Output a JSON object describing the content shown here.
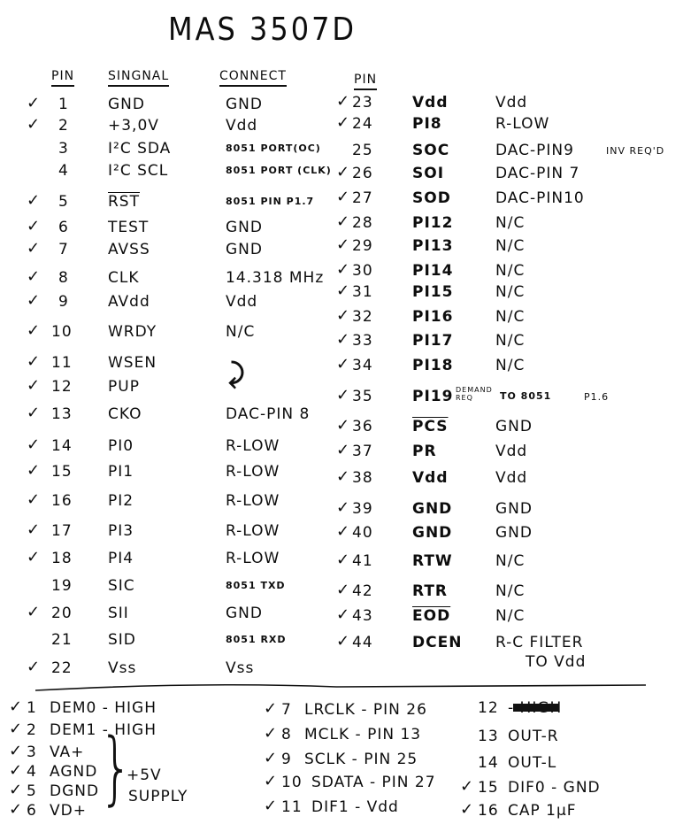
{
  "title": "MAS 3507D",
  "headers": {
    "pin": "PIN",
    "signal": "SINGNAL",
    "connect": "CONNECT",
    "pin2": "PIN"
  },
  "left_pins": [
    {
      "check": "✓",
      "pin": "1",
      "signal": "GND",
      "connect": "GND"
    },
    {
      "check": "✓",
      "pin": "2",
      "signal": "+3,0V",
      "connect": "Vdd"
    },
    {
      "check": "",
      "pin": "3",
      "signal": "I²C SDA",
      "connect": "8051 PORT(OC)"
    },
    {
      "check": "",
      "pin": "4",
      "signal": "I²C SCL",
      "connect": "8051 PORT (CLK)"
    },
    {
      "check": "✓",
      "pin": "5",
      "signal": "RST",
      "connect": "8051 PIN P1.7",
      "overline": true
    },
    {
      "check": "✓",
      "pin": "6",
      "signal": "TEST",
      "connect": "GND"
    },
    {
      "check": "✓",
      "pin": "7",
      "signal": "AVSS",
      "connect": "GND"
    },
    {
      "check": "✓",
      "pin": "8",
      "signal": "CLK",
      "connect": "14.318 MHz"
    },
    {
      "check": "✓",
      "pin": "9",
      "signal": "AVdd",
      "connect": "Vdd"
    },
    {
      "check": "✓",
      "pin": "10",
      "signal": "WRDY",
      "connect": "N/C"
    },
    {
      "check": "✓",
      "pin": "11",
      "signal": "WSEN",
      "connect": ""
    },
    {
      "check": "✓",
      "pin": "12",
      "signal": "PUP",
      "connect": ""
    },
    {
      "check": "✓",
      "pin": "13",
      "signal": "CKO",
      "connect": "DAC-PIN 8"
    },
    {
      "check": "✓",
      "pin": "14",
      "signal": "PI0",
      "connect": "R-LOW"
    },
    {
      "check": "✓",
      "pin": "15",
      "signal": "PI1",
      "connect": "R-LOW"
    },
    {
      "check": "✓",
      "pin": "16",
      "signal": "PI2",
      "connect": "R-LOW"
    },
    {
      "check": "✓",
      "pin": "17",
      "signal": "PI3",
      "connect": "R-LOW"
    },
    {
      "check": "✓",
      "pin": "18",
      "signal": "PI4",
      "connect": "R-LOW"
    },
    {
      "check": "",
      "pin": "19",
      "signal": "SIC",
      "connect": "8051 TXD"
    },
    {
      "check": "✓",
      "pin": "20",
      "signal": "SII",
      "connect": "GND"
    },
    {
      "check": "",
      "pin": "21",
      "signal": "SID",
      "connect": "8051 RXD"
    },
    {
      "check": "✓",
      "pin": "22",
      "signal": "Vss",
      "connect": "Vss"
    }
  ],
  "right_pins": [
    {
      "check": "✓",
      "pin": "23",
      "signal": "Vdd",
      "connect": "Vdd"
    },
    {
      "check": "✓",
      "pin": "24",
      "signal": "PI8",
      "connect": "R-LOW"
    },
    {
      "check": "",
      "pin": "25",
      "signal": "SOC",
      "connect": "DAC-PIN9",
      "note": "INV REQ'D"
    },
    {
      "check": "✓",
      "pin": "26",
      "signal": "SOI",
      "connect": "DAC-PIN 7"
    },
    {
      "check": "✓",
      "pin": "27",
      "signal": "SOD",
      "connect": "DAC-PIN10"
    },
    {
      "check": "✓",
      "pin": "28",
      "signal": "PI12",
      "connect": "N/C"
    },
    {
      "check": "✓",
      "pin": "29",
      "signal": "PI13",
      "connect": "N/C"
    },
    {
      "check": "✓",
      "pin": "30",
      "signal": "PI14",
      "connect": "N/C"
    },
    {
      "check": "✓",
      "pin": "31",
      "signal": "PI15",
      "connect": "N/C"
    },
    {
      "check": "✓",
      "pin": "32",
      "signal": "PI16",
      "connect": "N/C"
    },
    {
      "check": "✓",
      "pin": "33",
      "signal": "PI17",
      "connect": "N/C"
    },
    {
      "check": "✓",
      "pin": "34",
      "signal": "PI18",
      "connect": "N/C"
    },
    {
      "check": "✓",
      "pin": "35",
      "signal": "PI19",
      "connect": "TO 8051",
      "note_small": "DEMAND REQ",
      "note": "P1.6"
    },
    {
      "check": "✓",
      "pin": "36",
      "signal": "PCS",
      "connect": "GND",
      "overline": true
    },
    {
      "check": "✓",
      "pin": "37",
      "signal": "PR",
      "connect": "Vdd"
    },
    {
      "check": "✓",
      "pin": "38",
      "signal": "Vdd",
      "connect": "Vdd"
    },
    {
      "check": "✓",
      "pin": "39",
      "signal": "GND",
      "connect": "GND"
    },
    {
      "check": "✓",
      "pin": "40",
      "signal": "GND",
      "connect": "GND"
    },
    {
      "check": "✓",
      "pin": "41",
      "signal": "RTW",
      "connect": "N/C"
    },
    {
      "check": "✓",
      "pin": "42",
      "signal": "RTR",
      "connect": "N/C"
    },
    {
      "check": "✓",
      "pin": "43",
      "signal": "EOD",
      "connect": "N/C",
      "overline": true
    },
    {
      "check": "✓",
      "pin": "44",
      "signal": "DCEN",
      "connect": "R-C FILTER",
      "connect2": "TO Vdd"
    }
  ],
  "dac_col1": [
    {
      "check": "✓",
      "pin": "1",
      "text": "DEM0 - HIGH"
    },
    {
      "check": "✓",
      "pin": "2",
      "text": "DEM1 - HIGH"
    },
    {
      "check": "✓",
      "pin": "3",
      "text": "VA+"
    },
    {
      "check": "✓",
      "pin": "4",
      "text": "AGND"
    },
    {
      "check": "✓",
      "pin": "5",
      "text": "DGND"
    },
    {
      "check": "✓",
      "pin": "6",
      "text": "VD+"
    }
  ],
  "supply_note": [
    "+5V",
    "SUPPLY"
  ],
  "dac_col2": [
    {
      "check": "✓",
      "pin": "7",
      "text": "LRCLK - PIN 26"
    },
    {
      "check": "✓",
      "pin": "8",
      "text": "MCLK - PIN 13"
    },
    {
      "check": "✓",
      "pin": "9",
      "text": "SCLK - PIN 25"
    },
    {
      "check": "✓",
      "pin": "10",
      "text": "SDATA - PIN 27"
    },
    {
      "check": "✓",
      "pin": "11",
      "text": "DIF1 - Vdd"
    }
  ],
  "dac_col3": [
    {
      "check": "",
      "pin": "12",
      "text": "- HIGH"
    },
    {
      "check": "",
      "pin": "13",
      "text": "OUT-R"
    },
    {
      "check": "",
      "pin": "14",
      "text": "OUT-L"
    },
    {
      "check": "✓",
      "pin": "15",
      "text": "DIF0 - GND"
    },
    {
      "check": "✓",
      "pin": "16",
      "text": "CAP 1µF"
    }
  ]
}
